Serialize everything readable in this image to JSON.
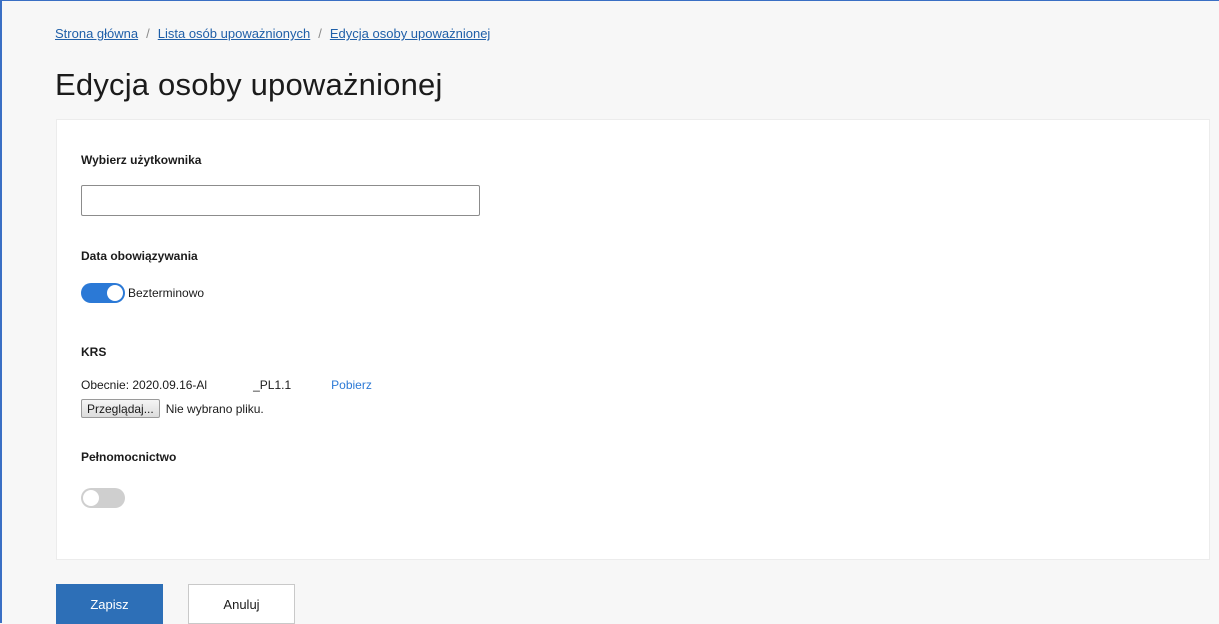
{
  "breadcrumb": {
    "items": [
      "Strona główna",
      "Lista osób upoważnionych",
      "Edycja osoby upoważnionej"
    ],
    "separator": "/"
  },
  "page": {
    "title": "Edycja osoby upoważnionej"
  },
  "form": {
    "user": {
      "label": "Wybierz użytkownika",
      "value": "",
      "placeholder": ""
    },
    "validity": {
      "label": "Data obowiązywania",
      "toggle_label": "Bezterminowo",
      "toggle_on": true
    },
    "krs": {
      "label": "KRS",
      "current_prefix": "Obecnie: 2020.09.16-Al",
      "current_suffix": "_PL1.1",
      "download_label": "Pobierz",
      "browse_label": "Przeglądaj...",
      "file_status": "Nie wybrano pliku."
    },
    "power_of_attorney": {
      "label": "Pełnomocnictwo",
      "toggle_on": false
    }
  },
  "actions": {
    "save_label": "Zapisz",
    "cancel_label": "Anuluj"
  },
  "colors": {
    "accent": "#2b79d6",
    "primary_button": "#2d6fb7",
    "link": "#1f5fa8"
  }
}
